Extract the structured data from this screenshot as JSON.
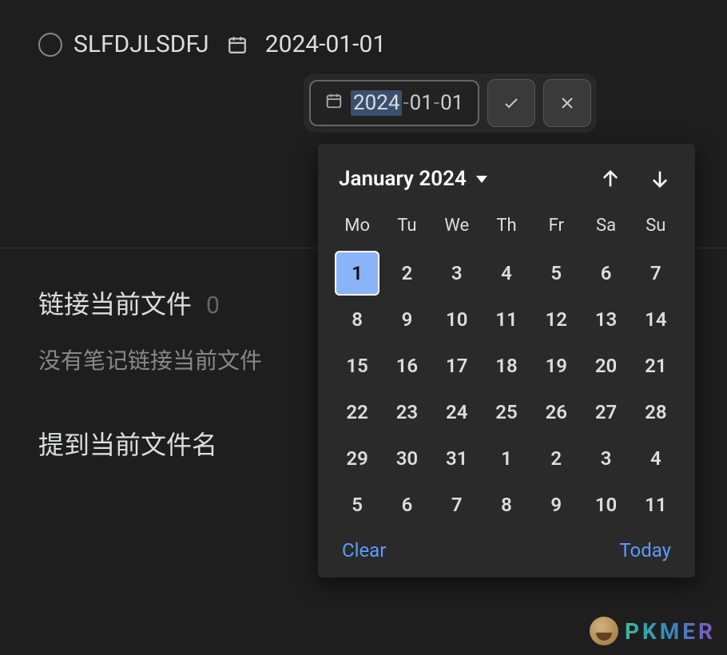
{
  "task": {
    "title": "SLFDJLSDFJ",
    "date_display": "2024-01-01"
  },
  "date_input": {
    "year": "2024",
    "month": "01",
    "day": "01"
  },
  "sections": {
    "linked": {
      "title": "链接当前文件",
      "count": "0",
      "empty": "没有笔记链接当前文件"
    },
    "mentions": {
      "title": "提到当前文件名"
    }
  },
  "calendar": {
    "month_label": "January 2024",
    "dow": [
      "Mo",
      "Tu",
      "We",
      "Th",
      "Fr",
      "Sa",
      "Su"
    ],
    "weeks": [
      [
        {
          "n": "1",
          "sel": true
        },
        {
          "n": "2"
        },
        {
          "n": "3"
        },
        {
          "n": "4"
        },
        {
          "n": "5"
        },
        {
          "n": "6"
        },
        {
          "n": "7"
        }
      ],
      [
        {
          "n": "8"
        },
        {
          "n": "9"
        },
        {
          "n": "10"
        },
        {
          "n": "11"
        },
        {
          "n": "12"
        },
        {
          "n": "13"
        },
        {
          "n": "14"
        }
      ],
      [
        {
          "n": "15"
        },
        {
          "n": "16"
        },
        {
          "n": "17"
        },
        {
          "n": "18"
        },
        {
          "n": "19"
        },
        {
          "n": "20"
        },
        {
          "n": "21"
        }
      ],
      [
        {
          "n": "22"
        },
        {
          "n": "23"
        },
        {
          "n": "24"
        },
        {
          "n": "25"
        },
        {
          "n": "26"
        },
        {
          "n": "27"
        },
        {
          "n": "28"
        }
      ],
      [
        {
          "n": "29"
        },
        {
          "n": "30"
        },
        {
          "n": "31"
        },
        {
          "n": "1"
        },
        {
          "n": "2"
        },
        {
          "n": "3"
        },
        {
          "n": "4"
        }
      ],
      [
        {
          "n": "5"
        },
        {
          "n": "6"
        },
        {
          "n": "7"
        },
        {
          "n": "8"
        },
        {
          "n": "9"
        },
        {
          "n": "10"
        },
        {
          "n": "11"
        }
      ]
    ],
    "clear": "Clear",
    "today": "Today"
  },
  "watermark": "PKMER"
}
